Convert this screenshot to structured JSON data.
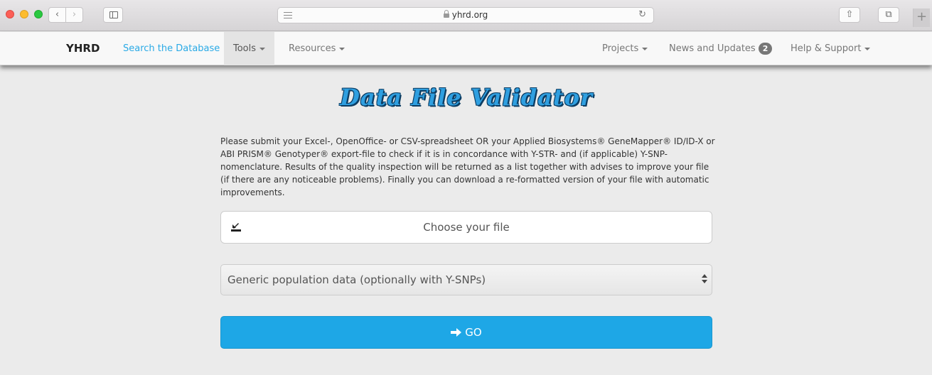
{
  "browser": {
    "url": "yhrd.org",
    "reload_icon": "↻",
    "back_icon": "‹",
    "forward_icon": "›",
    "share_icon": "⇧",
    "tabs_icon": "⧉",
    "new_tab_icon": "+"
  },
  "navbar": {
    "brand": "YHRD",
    "items": [
      {
        "label": "Search the Database"
      },
      {
        "label": "Tools"
      },
      {
        "label": "Resources"
      },
      {
        "label": "Projects"
      },
      {
        "label": "News and Updates"
      },
      {
        "label": "Help & Support"
      }
    ],
    "news_badge": "2",
    "active_item": "Tools",
    "accent_color": "#2aaae6"
  },
  "main": {
    "title": "Data File Validator",
    "description": "Please submit your Excel-, OpenOffice- or CSV-spreadsheet OR your Applied Biosystems® GeneMapper® ID/ID-X or ABI PRISM® Genotyper® export-file to check if it is in concordance with Y-STR- and (if applicable) Y-SNP-nomenclature. Results of the quality inspection will be returned as a list together with advises to improve your file (if there are any noticeable problems). Finally you can download a re-formatted version of your file with automatic improvements.",
    "file_label": "Choose your file",
    "select_value": "Generic population data (optionally with Y-SNPs)",
    "go_label": "GO",
    "go_color": "#1ea7e6"
  }
}
